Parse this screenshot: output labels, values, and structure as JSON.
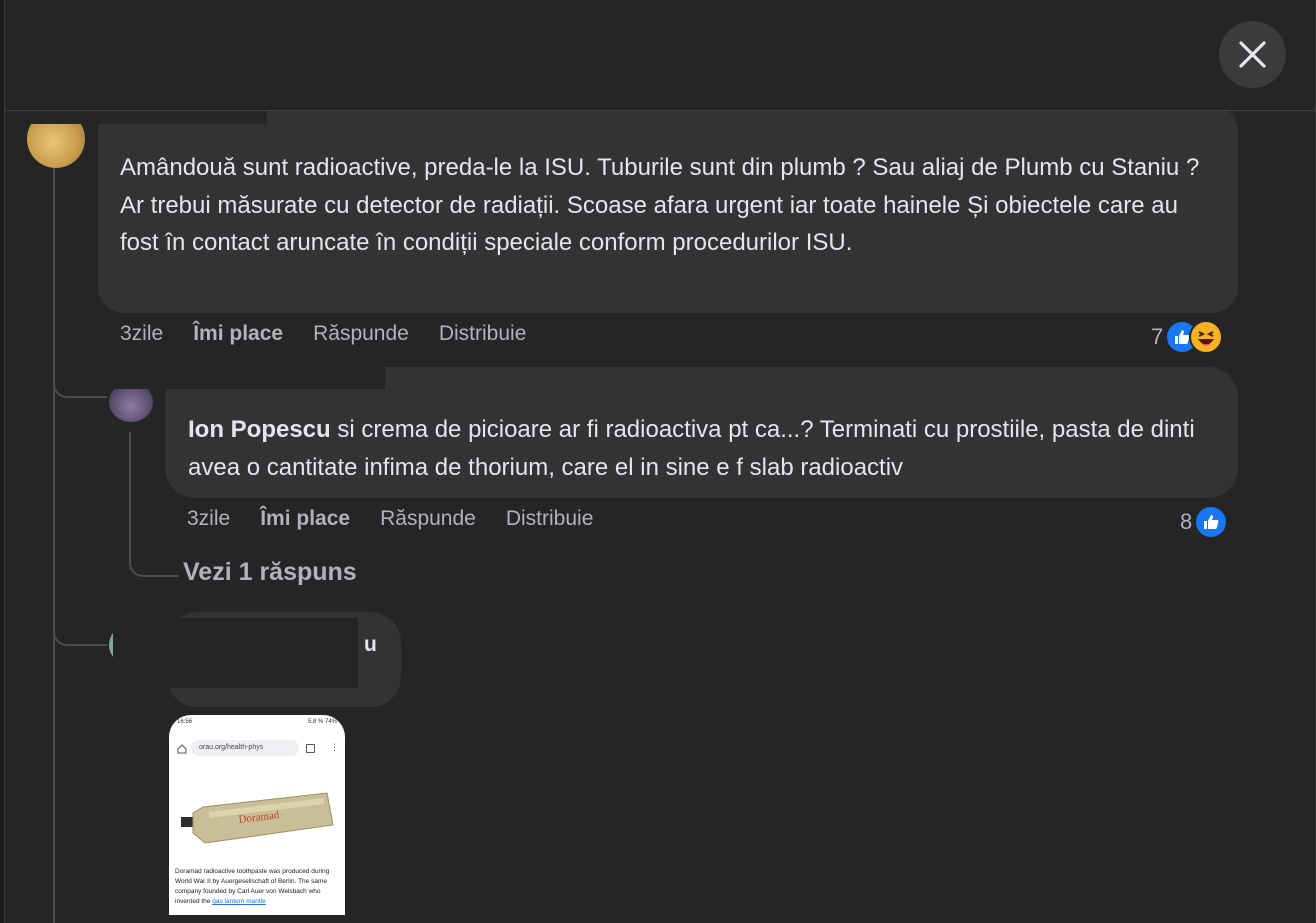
{
  "header": {
    "close_icon": "close-icon"
  },
  "comment1": {
    "text": "Amândouă sunt radioactive, preda-le la ISU. Tuburile sunt din plumb ? Sau aliaj de Plumb cu Staniu ? Ar trebui măsurate cu detector de radiații. Scoase afara urgent iar toate hainele Și obiectele care au fost în contact aruncate în condiții speciale conform procedurilor ISU.",
    "time": "3zile",
    "like_label": "Îmi place",
    "reply_label": "Răspunde",
    "share_label": "Distribuie",
    "reaction_count": "7"
  },
  "reply1": {
    "mention": "Ion Popescu",
    "text": " si crema de picioare ar fi radioactiva pt ca...? Terminati cu prostiile, pasta de dinti avea o cantitate infima de thorium, care el in sine e f slab radioactiv",
    "time": "3zile",
    "like_label": "Îmi place",
    "reply_label": "Răspunde",
    "share_label": "Distribuie",
    "reaction_count": "8",
    "see_replies": "Vezi 1 răspuns"
  },
  "reply2": {
    "name_fragment": "u"
  },
  "attachment": {
    "status_time": "16:56",
    "status_right": "5,8 % 74%",
    "url": "orau.org/health-phys",
    "caption": "Doramad radioactive toothpaste was produced during World War II by Auergesellschaft of Berlin. The same company founded by Carl Auer von Welsbach who invented the",
    "link_text": "gas lantern mantle",
    "tube_label": "Doramad"
  },
  "colors": {
    "background": "#252527",
    "bubble": "#333335",
    "text": "#e4e6eb",
    "secondary_text": "#b0b3b8",
    "like_blue": "#1877f2",
    "haha_yellow": "#f7b125"
  }
}
